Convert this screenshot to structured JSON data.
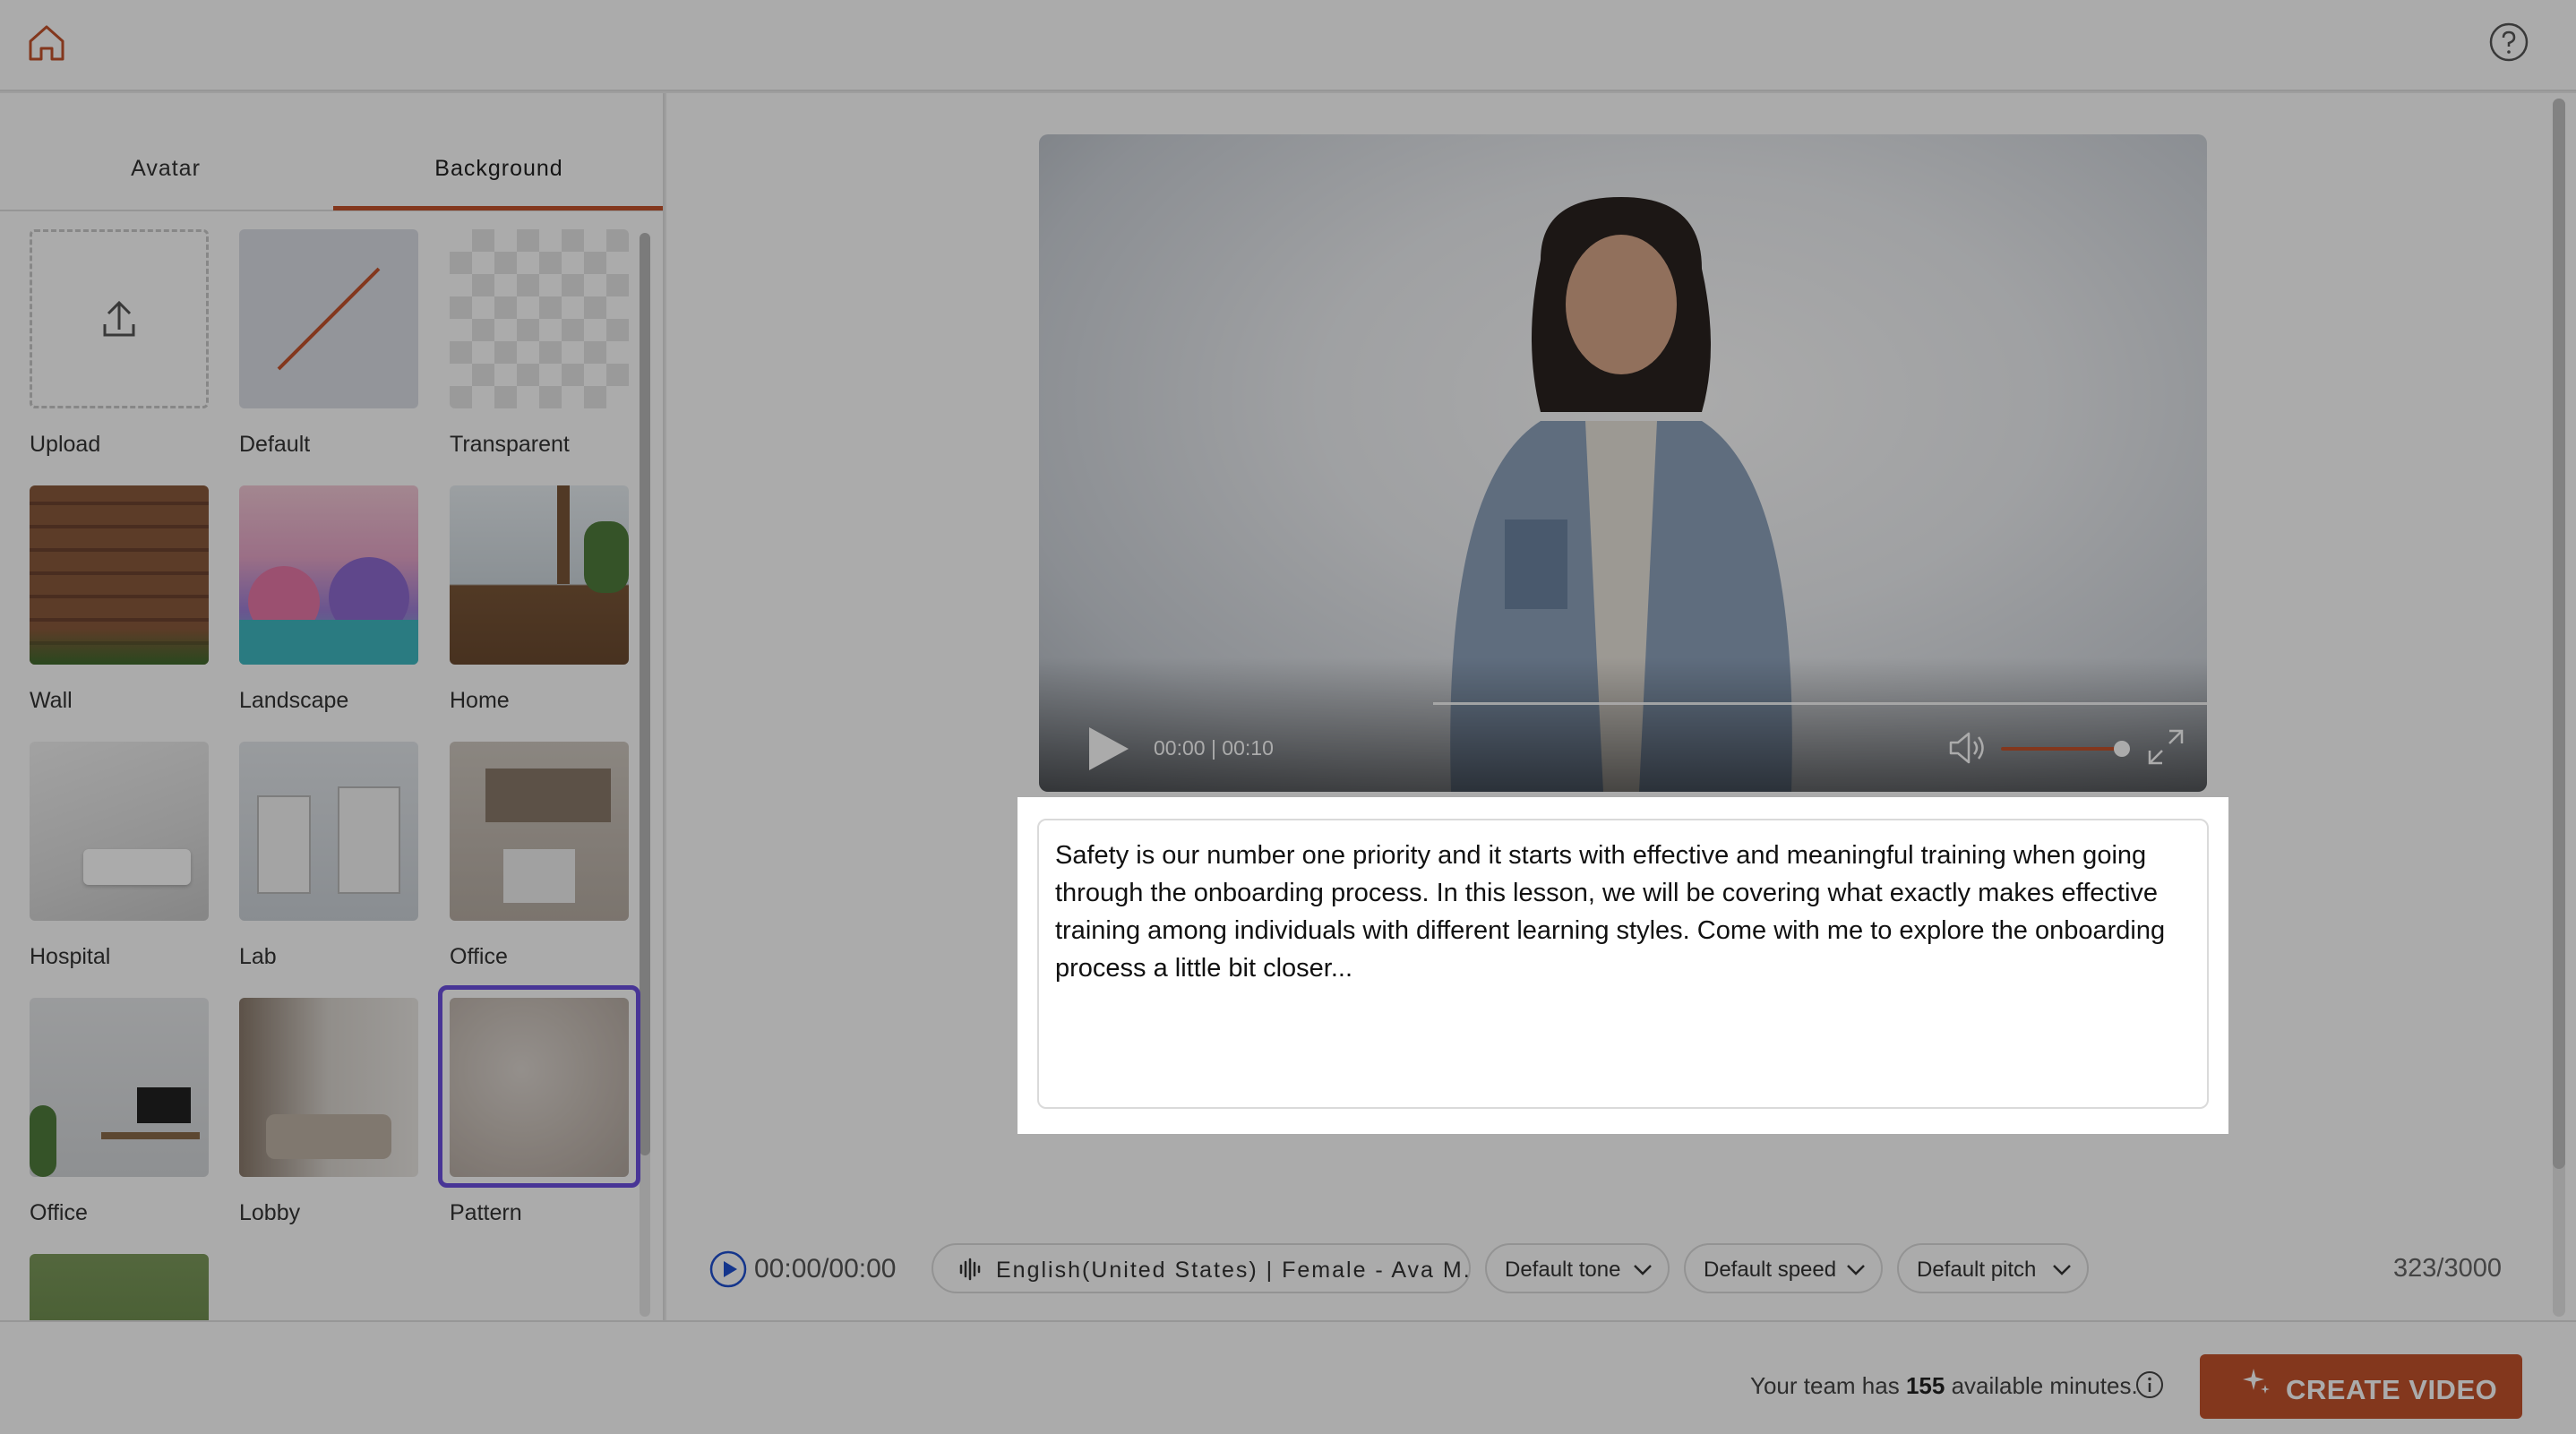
{
  "header": {
    "home_icon": "home-icon",
    "help_icon": "help-icon"
  },
  "left_panel": {
    "tabs": [
      {
        "label": "Avatar",
        "active": false
      },
      {
        "label": "Background",
        "active": true
      }
    ],
    "accent_color": "#c4532c",
    "selected_color": "#6c4fe0",
    "backgrounds": [
      {
        "label": "Upload"
      },
      {
        "label": "Default"
      },
      {
        "label": "Transparent"
      },
      {
        "label": "Wall"
      },
      {
        "label": "Landscape"
      },
      {
        "label": "Home"
      },
      {
        "label": "Hospital"
      },
      {
        "label": "Lab"
      },
      {
        "label": "Office"
      },
      {
        "label": "Office"
      },
      {
        "label": "Lobby"
      },
      {
        "label": "Pattern",
        "selected": true
      }
    ]
  },
  "player": {
    "time": "00:00 | 00:10"
  },
  "script": {
    "text": "Safety is our number one priority and it starts with effective and meaningful training when going through the onboarding process. In this lesson, we will be covering what exactly makes effective training among individuals with different learning styles. Come with me to explore the onboarding process a little bit closer..."
  },
  "toolbar": {
    "preview_time": "00:00/00:00",
    "voice": "English(United States) | Female - Ava M.",
    "tone": "Default tone",
    "speed": "Default speed",
    "pitch": "Default pitch",
    "char_count": "323/3000"
  },
  "footer": {
    "minutes_prefix": "Your team has",
    "minutes_value": "155",
    "minutes_suffix": "available minutes.",
    "create_label": "CREATE VIDEO"
  }
}
